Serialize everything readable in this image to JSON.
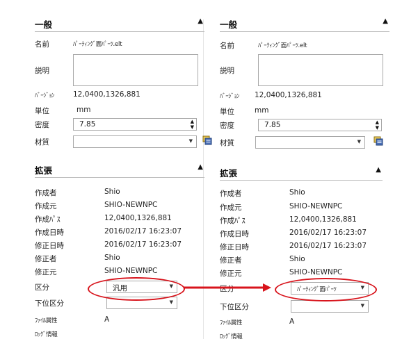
{
  "left": {
    "general": {
      "title": "一般",
      "name_label": "名前",
      "name_value": "ﾊﾟｰﾃｨﾝｸﾞ面ﾊﾟｰﾂ.elt",
      "desc_label": "説明",
      "version_label": "ﾊﾞｰｼﾞｮﾝ",
      "version_value": "12,0400,1326,881",
      "unit_label": "単位",
      "unit_value": "mm",
      "density_label": "密度",
      "density_value": "7.85",
      "material_label": "材質",
      "material_value": ""
    },
    "ext": {
      "title": "拡張",
      "creator_label": "作成者",
      "creator_value": "Shio",
      "origin_label": "作成元",
      "origin_value": "SHIO-NEWNPC",
      "path_label": "作成ﾊﾟｽ",
      "path_value": "12,0400,1326,881",
      "created_label": "作成日時",
      "created_value": "2016/02/17 16:23:07",
      "modified_label": "修正日時",
      "modified_value": "2016/02/17 16:23:07",
      "modifier_label": "修正者",
      "modifier_value": "Shio",
      "mod_origin_label": "修正元",
      "mod_origin_value": "SHIO-NEWNPC",
      "category_label": "区分",
      "category_value": "汎用",
      "subcat_label": "下位区分",
      "subcat_value": "",
      "fileattr_label": "ﾌｧｲﾙ属性",
      "fileattr_value": "A",
      "log_label": "ﾛｯｸﾞ情報"
    }
  },
  "right": {
    "general": {
      "title": "一般",
      "name_label": "名前",
      "name_value": "ﾊﾟｰﾃｨﾝｸﾞ面ﾊﾟｰﾂ.elt",
      "desc_label": "説明",
      "version_label": "ﾊﾞｰｼﾞｮﾝ",
      "version_value": "12,0400,1326,881",
      "unit_label": "単位",
      "unit_value": "mm",
      "density_label": "密度",
      "density_value": "7.85",
      "material_label": "材質",
      "material_value": ""
    },
    "ext": {
      "title": "拡張",
      "creator_label": "作成者",
      "creator_value": "Shio",
      "origin_label": "作成元",
      "origin_value": "SHIO-NEWNPC",
      "path_label": "作成ﾊﾟｽ",
      "path_value": "12,0400,1326,881",
      "created_label": "作成日時",
      "created_value": "2016/02/17 16:23:07",
      "modified_label": "修正日時",
      "modified_value": "2016/02/17 16:23:07",
      "modifier_label": "修正者",
      "modifier_value": "Shio",
      "mod_origin_label": "修正元",
      "mod_origin_value": "SHIO-NEWNPC",
      "category_label": "区分",
      "category_value": "ﾊﾟｰﾃｨﾝｸﾞ面ﾊﾟｰﾂ",
      "subcat_label": "下位区分",
      "subcat_value": "",
      "fileattr_label": "ﾌｧｲﾙ属性",
      "fileattr_value": "A",
      "log_label": "ﾛｯｸﾞ情報"
    }
  },
  "icons": {
    "caret": "chevron-up-icon",
    "dropdown": "chevron-down-icon",
    "spinner": "spinner-icon",
    "browse": "database-browse-icon"
  },
  "colors": {
    "highlight": "#d8141c",
    "border": "#a8a8a8",
    "divider": "#bfbfbf"
  }
}
